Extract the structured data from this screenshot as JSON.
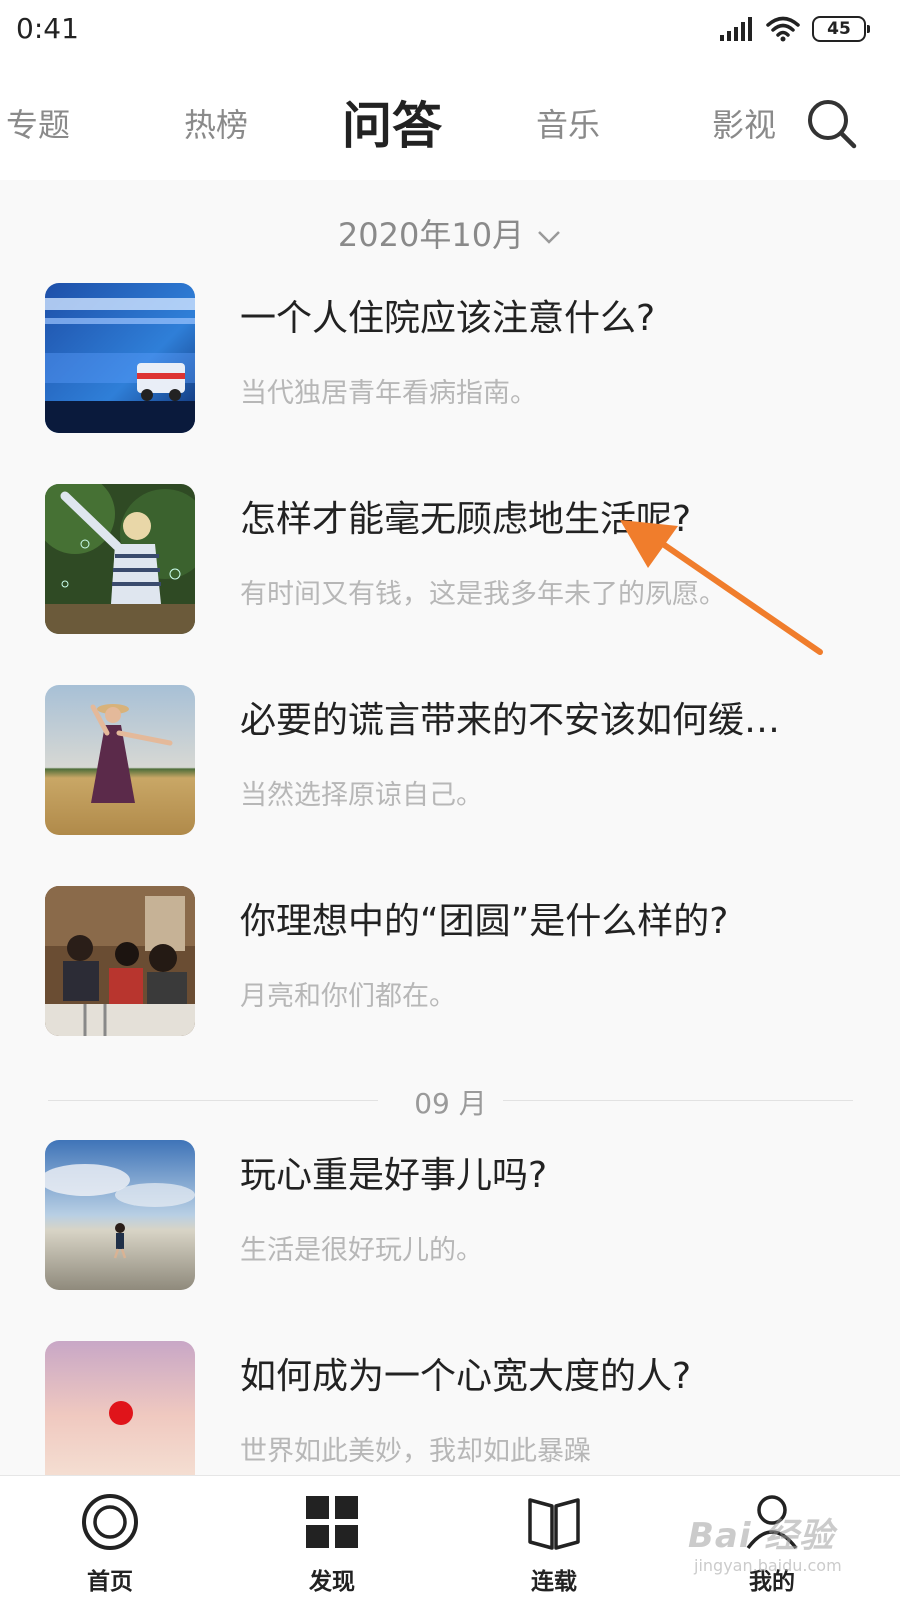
{
  "status_bar": {
    "time": "0:41",
    "battery": "45"
  },
  "tabs": [
    {
      "label": "专题",
      "active": false
    },
    {
      "label": "热榜",
      "active": false
    },
    {
      "label": "问答",
      "active": true
    },
    {
      "label": "音乐",
      "active": false
    },
    {
      "label": "影视",
      "active": false
    }
  ],
  "month_selector": {
    "label": "2020年10月"
  },
  "section_divider": {
    "label": "09 月"
  },
  "items": [
    {
      "title": "一个人住院应该注意什么?",
      "subtitle": "当代独居青年看病指南。",
      "thumb": "ambulance-photo"
    },
    {
      "title": "怎样才能毫无顾虑地生活呢?",
      "subtitle": "有时间又有钱，这是我多年未了的夙愿。",
      "thumb": "child-bubbles-photo"
    },
    {
      "title": "必要的谎言带来的不安该如何缓…",
      "subtitle": "当然选择原谅自己。",
      "thumb": "woman-field-photo"
    },
    {
      "title": "你理想中的“团圆”是什么样的?",
      "subtitle": "月亮和你们都在。",
      "thumb": "family-dinner-photo"
    },
    {
      "title": "玩心重是好事儿吗?",
      "subtitle": "生活是很好玩儿的。",
      "thumb": "beach-child-photo"
    },
    {
      "title": "如何成为一个心宽大度的人?",
      "subtitle": "世界如此美妙，我却如此暴躁",
      "thumb": "red-sun-photo"
    }
  ],
  "bottom_nav": [
    {
      "label": "首页",
      "icon": "home-circle-icon"
    },
    {
      "label": "发现",
      "icon": "grid-icon"
    },
    {
      "label": "连载",
      "icon": "book-icon"
    },
    {
      "label": "我的",
      "icon": "person-icon"
    }
  ],
  "watermark": {
    "main": "Bai 经验",
    "sub": "jingyan.baidu.com"
  },
  "colors": {
    "annotation_arrow": "#f07d2c",
    "text_primary": "#222222",
    "text_secondary": "#b7b7b7",
    "tab_inactive": "#8a8a8a"
  }
}
